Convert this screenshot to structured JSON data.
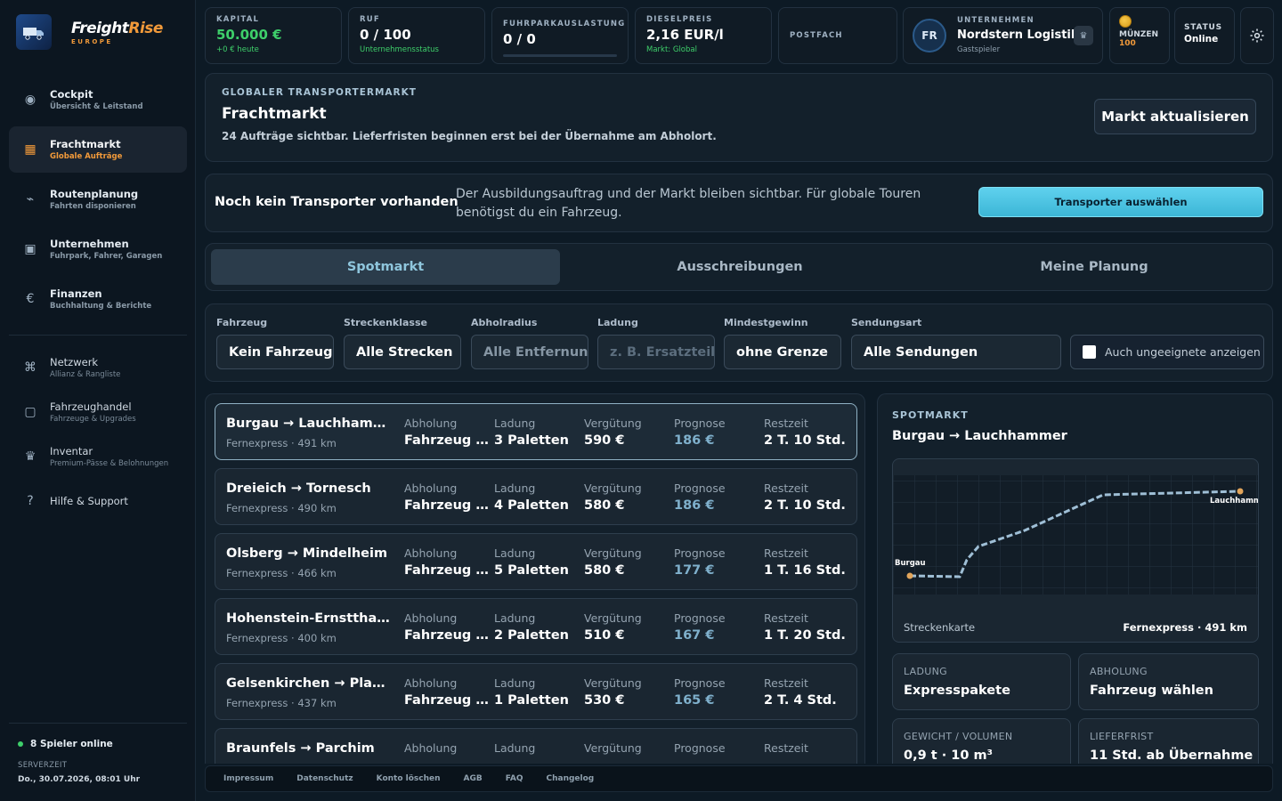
{
  "brand": {
    "name_part1": "Freight",
    "name_part2": "Rise",
    "region": "EUROPE"
  },
  "sidebar": {
    "items": [
      {
        "label": "Cockpit",
        "sub": "Übersicht & Leitstand",
        "icon": "◉"
      },
      {
        "label": "Frachtmarkt",
        "sub": "Globale Aufträge",
        "icon": "▦"
      },
      {
        "label": "Routenplanung",
        "sub": "Fahrten disponieren",
        "icon": "⌁"
      },
      {
        "label": "Unternehmen",
        "sub": "Fuhrpark, Fahrer, Garagen",
        "icon": "▣"
      },
      {
        "label": "Finanzen",
        "sub": "Buchhaltung & Berichte",
        "icon": "€"
      }
    ],
    "secondary": [
      {
        "label": "Netzwerk",
        "sub": "Allianz & Rangliste",
        "icon": "⌘"
      },
      {
        "label": "Fahrzeughandel",
        "sub": "Fahrzeuge & Upgrades",
        "icon": "▢"
      },
      {
        "label": "Inventar",
        "sub": "Premium-Pässe & Belohnungen",
        "icon": "♛"
      },
      {
        "label": "Hilfe & Support",
        "icon": "?"
      }
    ],
    "online": "8 Spieler online",
    "server_label": "SERVERZEIT",
    "server_time": "Do., 30.07.2026, 08:01 Uhr"
  },
  "header": {
    "kapital": {
      "label": "KAPITAL",
      "value": "50.000 €",
      "sub": "+0 € heute"
    },
    "ruf": {
      "label": "RUF",
      "value": "0 / 100",
      "sub": "Unternehmensstatus"
    },
    "fuhrpark": {
      "label": "FUHRPARKAUSLASTUNG",
      "value": "0 / 0",
      "fill": 0
    },
    "diesel": {
      "label": "DIESELPREIS",
      "value": "2,16 EUR/l",
      "sub": "Markt: Global"
    },
    "postfach": {
      "label": "POSTFACH"
    },
    "company": {
      "initials": "FR",
      "label": "UNTERNEHMEN",
      "name": "Nordstern Logistik",
      "sub": "Gastspieler"
    },
    "coins": {
      "label": "MÜNZEN",
      "value": "100"
    },
    "status": {
      "label": "STATUS",
      "value": "Online"
    }
  },
  "market": {
    "kicker": "GLOBALER TRANSPORTERMARKT",
    "title": "Frachtmarkt",
    "desc": "24 Aufträge sichtbar. Lieferfristen beginnen erst bei der Übernahme am Abholort.",
    "refresh": "Markt aktualisieren"
  },
  "notice": {
    "title": "Noch kein Transporter vorhanden",
    "text": "Der Ausbildungsauftrag und der Markt bleiben sichtbar. Für globale Touren benötigst du ein Fahrzeug.",
    "button": "Transporter auswählen"
  },
  "tabs": [
    "Spotmarkt",
    "Ausschreibungen",
    "Meine Planung"
  ],
  "filters": {
    "fahrzeug": {
      "label": "Fahrzeug",
      "value": "Kein Fahrzeug"
    },
    "strecke": {
      "label": "Streckenklasse",
      "value": "Alle Strecken"
    },
    "radius": {
      "label": "Abholradius",
      "value": "Alle Entfernungen"
    },
    "ladung": {
      "label": "Ladung",
      "placeholder": "z. B. Ersatzteile"
    },
    "gewinn": {
      "label": "Mindestgewinn",
      "value": "ohne Grenze"
    },
    "sendung": {
      "label": "Sendungsart",
      "value": "Alle Sendungen"
    },
    "ungeeignet": "Auch ungeeignete anzeigen"
  },
  "columns": {
    "abholung": "Abholung",
    "ladung": "Ladung",
    "verguetung": "Vergütung",
    "prognose": "Prognose",
    "restzeit": "Restzeit"
  },
  "orders": [
    {
      "route": "Burgau → Lauchhammer",
      "meta": "Fernexpress · 491 km",
      "abholung": "Fahrzeug …",
      "ladung": "3 Paletten",
      "verguetung": "590 €",
      "prognose": "186 €",
      "restzeit": "2 T. 10 Std."
    },
    {
      "route": "Dreieich → Tornesch",
      "meta": "Fernexpress · 490 km",
      "abholung": "Fahrzeug …",
      "ladung": "4 Paletten",
      "verguetung": "580 €",
      "prognose": "186 €",
      "restzeit": "2 T. 10 Std."
    },
    {
      "route": "Olsberg → Mindelheim",
      "meta": "Fernexpress · 466 km",
      "abholung": "Fahrzeug …",
      "ladung": "5 Paletten",
      "verguetung": "580 €",
      "prognose": "177 €",
      "restzeit": "1 T. 16 Std."
    },
    {
      "route": "Hohenstein-Ernstthal …",
      "meta": "Fernexpress · 400 km",
      "abholung": "Fahrzeug …",
      "ladung": "2 Paletten",
      "verguetung": "510 €",
      "prognose": "167 €",
      "restzeit": "1 T. 20 Std."
    },
    {
      "route": "Gelsenkirchen → Plauen",
      "meta": "Fernexpress · 437 km",
      "abholung": "Fahrzeug …",
      "ladung": "1 Paletten",
      "verguetung": "530 €",
      "prognose": "165 €",
      "restzeit": "2 T. 4 Std."
    },
    {
      "route": "Braunfels → Parchim",
      "meta": "",
      "abholung": "",
      "ladung": "",
      "verguetung": "",
      "prognose": "",
      "restzeit": ""
    }
  ],
  "detail": {
    "kicker": "SPOTMARKT",
    "route": "Burgau → Lauchhammer",
    "map_start": "Burgau",
    "map_end": "Lauchhammer",
    "map_label": "Streckenkarte",
    "map_info": "Fernexpress · 491 km",
    "cards": [
      {
        "label": "LADUNG",
        "value": "Expresspakete"
      },
      {
        "label": "ABHOLUNG",
        "value": "Fahrzeug wählen"
      },
      {
        "label": "GEWICHT / VOLUMEN",
        "value": "0,9 t · 10 m³"
      },
      {
        "label": "LIEFERFRIST",
        "value": "11 Std. ab Übernahme"
      }
    ]
  },
  "footer": [
    "Impressum",
    "Datenschutz",
    "Konto löschen",
    "AGB",
    "FAQ",
    "Changelog"
  ],
  "colors": {
    "accent_orange": "#f29a3a",
    "accent_cyan": "#4cc3e0",
    "online_green": "#3ecf6a",
    "prognose_blue": "#7fb0cc"
  }
}
